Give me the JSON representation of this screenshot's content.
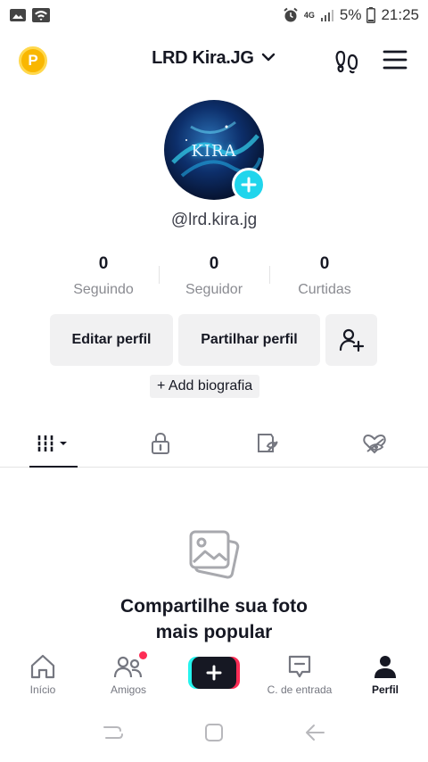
{
  "status_bar": {
    "network_type": "4G",
    "battery": "5%",
    "time": "21:25",
    "icons": [
      "gallery-icon",
      "wifi-icon",
      "alarm-icon",
      "signal-icon",
      "battery-icon"
    ]
  },
  "header": {
    "coin_letter": "P",
    "username": "LRD Kira.JG",
    "icons": [
      "chevron-down-icon",
      "footprint-icon",
      "menu-icon"
    ]
  },
  "profile": {
    "avatar_text": "KIRA",
    "handle": "@lrd.kira.jg"
  },
  "stats": [
    {
      "value": "0",
      "label": "Seguindo"
    },
    {
      "value": "0",
      "label": "Seguidor"
    },
    {
      "value": "0",
      "label": "Curtidas"
    }
  ],
  "actions": {
    "edit": "Editar perfil",
    "share": "Partilhar perfil",
    "add_bio": "+ Add biografia"
  },
  "tabs": [
    "videos-grid-icon",
    "lock-icon",
    "reposts-icon",
    "liked-icon"
  ],
  "empty_state": {
    "line1": "Compartilhe sua foto",
    "line2": "mais popular"
  },
  "bottom_nav": [
    {
      "label": "Início",
      "icon": "home-icon"
    },
    {
      "label": "Amigos",
      "icon": "friends-icon"
    },
    {
      "label": "",
      "icon": "create-icon"
    },
    {
      "label": "C. de entrada",
      "icon": "inbox-icon"
    },
    {
      "label": "Perfil",
      "icon": "profile-icon"
    }
  ],
  "colors": {
    "accent_cyan": "#20d5ec",
    "accent_red": "#fe2c55",
    "coin": "#f9b701",
    "text": "#161823",
    "muted": "#8a8b91",
    "button_bg": "#f1f1f2"
  }
}
